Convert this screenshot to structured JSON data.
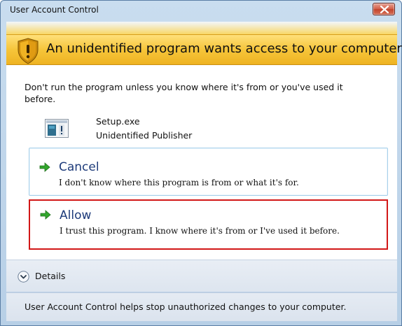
{
  "window": {
    "title": "User Account Control",
    "close_icon": "close-icon"
  },
  "banner": {
    "icon": "shield-warning-icon",
    "text": "An unidentified program wants access to your computer",
    "color": "#f6c53a"
  },
  "warning": {
    "text": "Don't run the program unless you know where it's from or you've used it before."
  },
  "program": {
    "icon": "program-icon",
    "name": "Setup.exe",
    "publisher": "Unidentified Publisher"
  },
  "options": [
    {
      "icon": "green-arrow-icon",
      "title": "Cancel",
      "description": "I don't know where this program is from or what it's for."
    },
    {
      "icon": "green-arrow-icon",
      "title": "Allow",
      "description": "I trust this program. I know where it's from or I've used it before.",
      "highlight_color": "#d21717"
    }
  ],
  "details": {
    "icon": "chevron-down-icon",
    "label": "Details"
  },
  "footer": {
    "text": "User Account Control helps stop unauthorized changes to your computer."
  }
}
